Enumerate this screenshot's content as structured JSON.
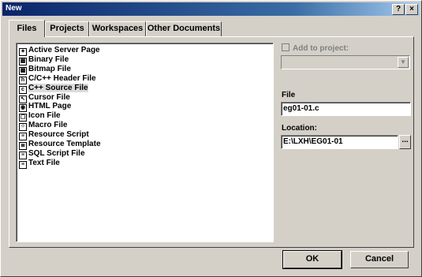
{
  "window": {
    "title": "New",
    "help_btn": "?",
    "close_btn": "×"
  },
  "tabs": [
    {
      "label": "Files",
      "active": true
    },
    {
      "label": "Projects",
      "active": false
    },
    {
      "label": "Workspaces",
      "active": false
    },
    {
      "label": "Other Documents",
      "active": false
    }
  ],
  "file_types": [
    {
      "label": "Active Server Page",
      "icon": "asp-icon",
      "glyph": "✦"
    },
    {
      "label": "Binary File",
      "icon": "binary-icon",
      "glyph": "▦"
    },
    {
      "label": "Bitmap File",
      "icon": "bitmap-icon",
      "glyph": "▩"
    },
    {
      "label": "C/C++ Header File",
      "icon": "header-file-icon",
      "glyph": "h"
    },
    {
      "label": "C++ Source File",
      "icon": "source-file-icon",
      "glyph": "c",
      "selected": true
    },
    {
      "label": "Cursor File",
      "icon": "cursor-icon",
      "glyph": "↖"
    },
    {
      "label": "HTML Page",
      "icon": "html-icon",
      "glyph": "◉"
    },
    {
      "label": "Icon File",
      "icon": "icon-file-icon",
      "glyph": "▢"
    },
    {
      "label": "Macro File",
      "icon": "macro-icon",
      "glyph": "⁘"
    },
    {
      "label": "Resource Script",
      "icon": "resource-script-icon",
      "glyph": "≡"
    },
    {
      "label": "Resource Template",
      "icon": "resource-template-icon",
      "glyph": "≣"
    },
    {
      "label": "SQL Script File",
      "icon": "sql-icon",
      "glyph": "≡"
    },
    {
      "label": "Text File",
      "icon": "text-file-icon",
      "glyph": "≡"
    }
  ],
  "add_to_project": {
    "label": "Add to project:",
    "checked": false,
    "enabled": false,
    "selected_value": ""
  },
  "file": {
    "label": "File",
    "value": "eg01-01.c"
  },
  "location": {
    "label": "Location:",
    "value": "E:\\LXH\\EG01-01",
    "browse_label": "..."
  },
  "buttons": {
    "ok": "OK",
    "cancel": "Cancel"
  }
}
